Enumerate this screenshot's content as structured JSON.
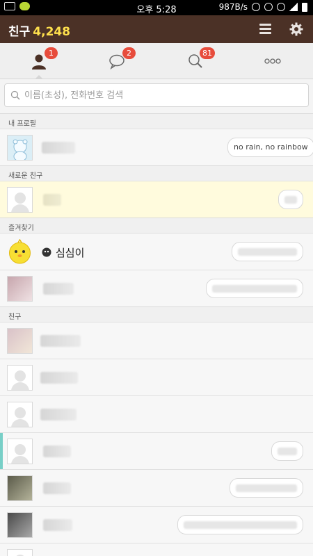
{
  "status_bar": {
    "time": "오후 5:28",
    "net_speed": "987B/s"
  },
  "header": {
    "title": "친구",
    "count": "4,248"
  },
  "tabs": [
    {
      "name": "friends",
      "badge": "1"
    },
    {
      "name": "chats",
      "badge": "2"
    },
    {
      "name": "find",
      "badge": "81"
    },
    {
      "name": "more",
      "badge": ""
    }
  ],
  "search": {
    "placeholder": "이름(초성), 전화번호 검색"
  },
  "sections": {
    "my_profile": "내 프로필",
    "new_friends": "새로운 친구",
    "favorites": "즐겨찾기",
    "friends": "친구"
  },
  "my_profile": {
    "status_message": "no rain, no rainbow"
  },
  "favorites": [
    {
      "name": "심심이"
    }
  ],
  "colors": {
    "header_bg": "#4b3126",
    "accent_count": "#ffe14d",
    "badge": "#e74c3c",
    "new_friend_bg": "#fffbdd",
    "row_accent": "#78cfc7"
  }
}
